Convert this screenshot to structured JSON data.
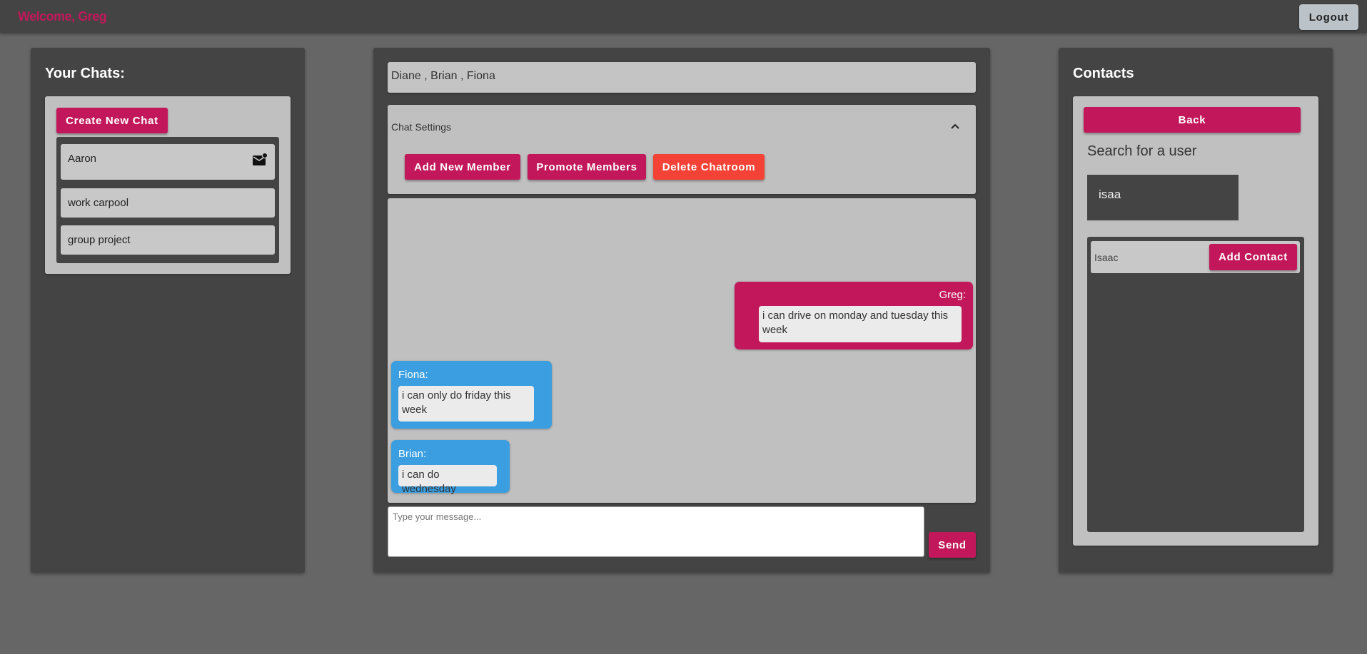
{
  "header": {
    "welcome": "Welcome, Greg",
    "logout_label": "Logout"
  },
  "chats_panel": {
    "title": "Your Chats:",
    "create_label": "Create New Chat",
    "items": [
      {
        "name": "Aaron",
        "icon": "mail-unread-icon"
      },
      {
        "name": "work carpool"
      },
      {
        "name": "group project"
      }
    ]
  },
  "chat": {
    "members": "Diane , Brian , Fiona",
    "settings_label": "Chat Settings",
    "add_member_label": "Add New Member",
    "promote_label": "Promote Members",
    "delete_label": "Delete Chatroom",
    "messages": [
      {
        "sender": "Greg:",
        "text": "i can drive on monday and tuesday this week",
        "own": true
      },
      {
        "sender": "Fiona:",
        "text": "i can only do friday this week",
        "own": false
      },
      {
        "sender": "Brian:",
        "text": "i can do wednesday",
        "own": false
      }
    ],
    "input_placeholder": "Type your message...",
    "send_label": "Send"
  },
  "contacts_panel": {
    "title": "Contacts",
    "back_label": "Back",
    "search_heading": "Search for a user",
    "search_value": "isaa",
    "results": [
      {
        "name": "Isaac",
        "action_label": "Add Contact"
      }
    ]
  },
  "colors": {
    "accent": "#c2185b",
    "danger": "#f44336",
    "other_bubble": "#3a9ee0",
    "panel": "#444444",
    "background": "#666666"
  }
}
